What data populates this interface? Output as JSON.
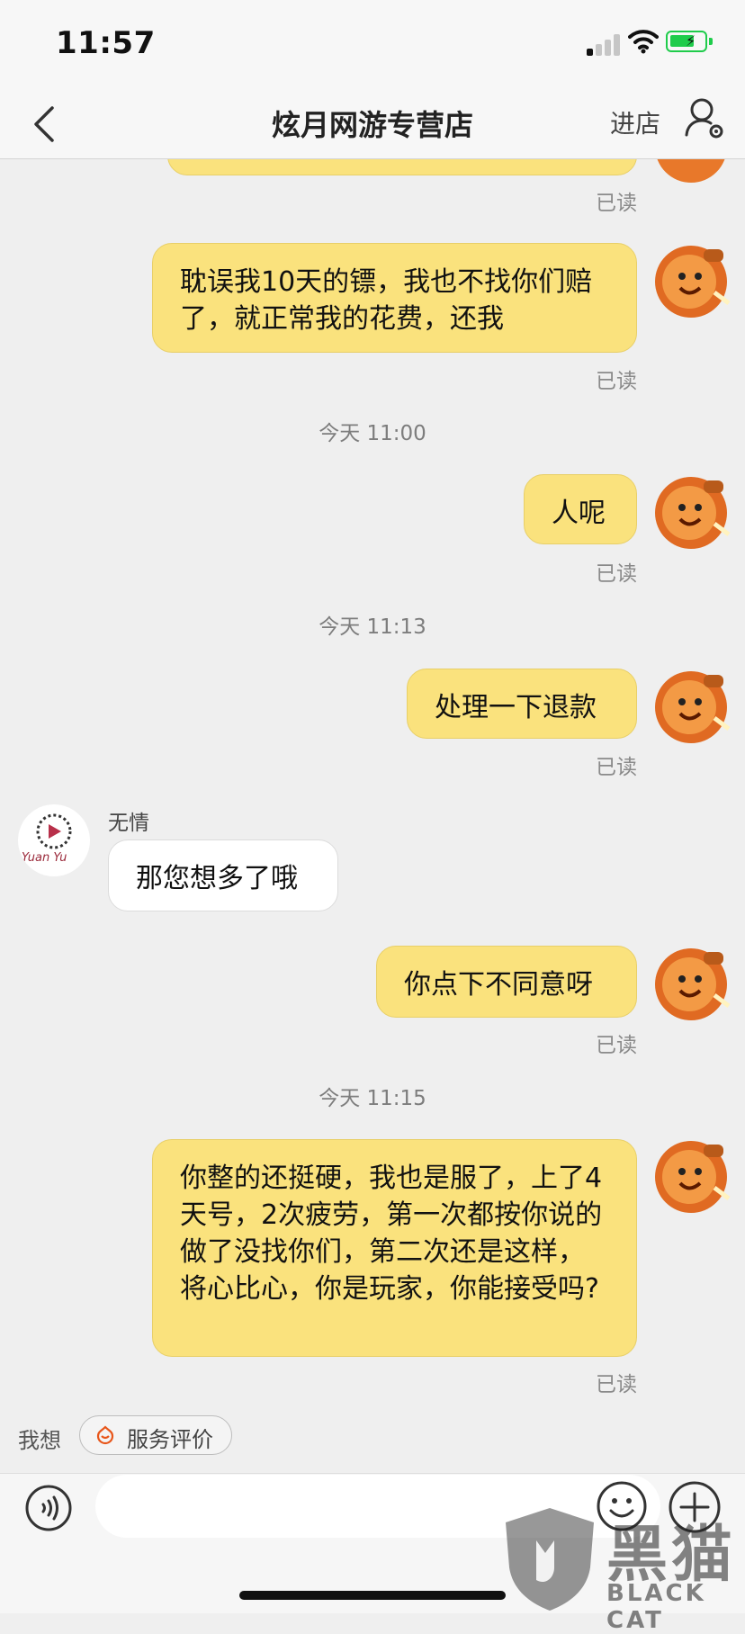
{
  "status_bar": {
    "time": "11:57"
  },
  "nav": {
    "title": "炫月网游专营店",
    "enter_shop": "进店"
  },
  "messages": {
    "m1": {
      "text": "耽误我10天的镖，我也不找你们赔了，就正常我的花费，还我",
      "read": "已读"
    },
    "stamp1": "今天 11:00",
    "m2": {
      "text": "人呢",
      "read": "已读"
    },
    "stamp2": "今天 11:13",
    "m3": {
      "text": "处理一下退款",
      "read": "已读"
    },
    "peer": {
      "name": "无情",
      "avatar_text": "Yuan Yu",
      "text": "那您想多了哦"
    },
    "m4": {
      "text": "你点下不同意呀",
      "read": "已读"
    },
    "stamp3": "今天 11:15",
    "m5": {
      "text": "你整的还挺硬，我也是服了，上了4天号，2次疲劳，第一次都按你说的做了没找你们，第二次还是这样，将心比心，你是玩家，你能接受吗?",
      "read": "已读"
    },
    "top_read": "已读"
  },
  "quick_bar": {
    "label": "我想",
    "chip": "服务评价"
  },
  "input": {
    "placeholder": ""
  },
  "watermark": {
    "cn": "黑猫",
    "en": "BLACK CAT"
  },
  "colors": {
    "my_bubble": "#fae27d",
    "peer_bubble": "#ffffff",
    "background": "#efefef",
    "battery": "#1fcc4b"
  },
  "icons": [
    "back-chevron-icon",
    "user-settings-icon",
    "voice-icon",
    "emoji-icon",
    "plus-icon",
    "service-rating-icon"
  ]
}
